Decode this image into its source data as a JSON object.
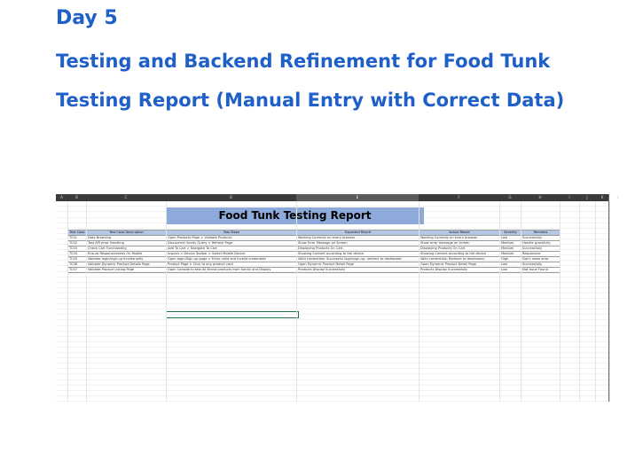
{
  "headings": {
    "day": "Day 5",
    "subtitle": "Testing and Backend Refinement for Food Tunk",
    "report": "Testing Report (Manual Entry with Correct Data)"
  },
  "spreadsheet": {
    "column_letters": [
      "A",
      "B",
      "C",
      "D",
      "E",
      "F",
      "G",
      "H",
      "I",
      "J",
      "K",
      "L"
    ],
    "selected_column": "E",
    "title": "Food Tunk Testing Report",
    "headers": [
      "Test Case",
      "Test Case Description",
      "Test Steps",
      "Expected Result",
      "Actual Result",
      "Severity",
      "Remarks"
    ],
    "rows": [
      [
        "TC01",
        "Data Browsing",
        "Open Products Page > Validate Products",
        "Working Correctly on every browser",
        "Working Correctly on every browser",
        "Low",
        "Successfully"
      ],
      [
        "TC02",
        "Test API error Handling",
        "Disconnect Sanity Query > Refresh Page",
        "Show Error Message on Screen",
        "Show error message on screen",
        "Medium",
        "Handle gracefully"
      ],
      [
        "TC03",
        "Check Cart Functionality",
        "Add To Cart > Navigate To Cart",
        "Displaying Products On Cart",
        "Displaying Products On Cart",
        "Medium",
        "Successfully"
      ],
      [
        "TC04",
        "Ensure Responsiveness On Mobile",
        "Inspect > Device Toolbar > Select Mobile Device",
        "Showing Content according to the device",
        "Showing Content according to the device",
        "Medium",
        "Responsive"
      ],
      [
        "TC05",
        "Validate login/sign-up functionality",
        "Open login/Sign-up page > Enter valid and invalid credentials",
        "Valid credentials: Successful login/sign-up, redirect to dashboard.",
        "Valid credentials: Redirect to dashboard.",
        "High",
        "Don't show error"
      ],
      [
        "TC06",
        "Validate Dynamic Product Details Page",
        "Product Page > Click to any product card",
        "Open Dynamic Product Detail Page",
        "Open Dynamic Product Detail Page",
        "Low",
        "Successfully"
      ],
      [
        "TC07",
        "Validate Product Listing Page",
        "Open Console to test All Brand products from Sanity and Display",
        "Products Display Successfully",
        "Products Display Successfully",
        "Low",
        "Not Issue Found"
      ]
    ]
  }
}
